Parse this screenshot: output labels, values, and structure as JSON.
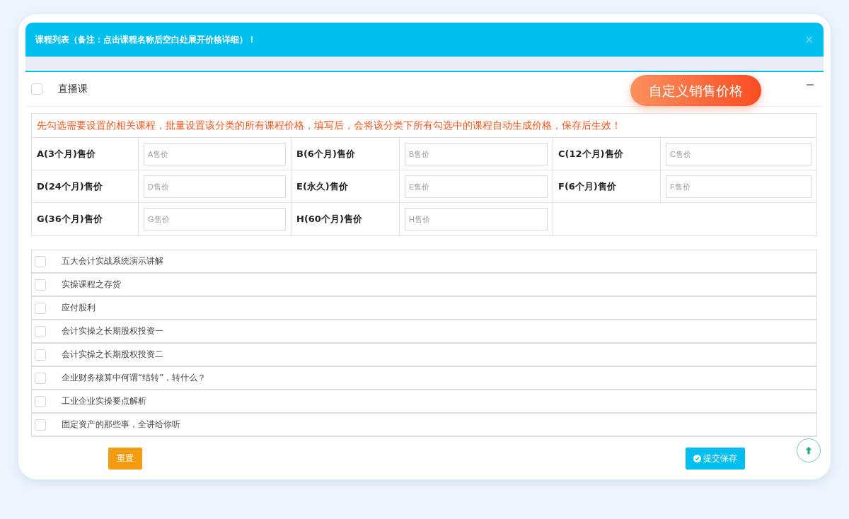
{
  "dialog": {
    "title": "课程列表（备注：点击课程名称后空白处展开价格详细）！",
    "close": "×"
  },
  "category": {
    "label": "直播课",
    "checked": false
  },
  "badge": "自定义销售价格",
  "notice": "先勾选需要设置的相关课程，批量设置该分类的所有课程价格，填写后，会将该分类下所有勾选中的课程自动生成价格，保存后生效！",
  "price_fields": [
    {
      "label": "A(3个月)售价",
      "placeholder": "A售价"
    },
    {
      "label": "B(6个月)售价",
      "placeholder": "B售价"
    },
    {
      "label": "C(12个月)售价",
      "placeholder": "C售价"
    },
    {
      "label": "D(24个月)售价",
      "placeholder": "D售价"
    },
    {
      "label": "E(永久)售价",
      "placeholder": "E售价"
    },
    {
      "label": "F(6个月)售价",
      "placeholder": "F售价"
    },
    {
      "label": "G(36个月)售价",
      "placeholder": "G售价"
    },
    {
      "label": "H(60个月)售价",
      "placeholder": "H售价"
    }
  ],
  "courses": [
    {
      "name": "五大会计实战系统演示讲解",
      "checked": false
    },
    {
      "name": "实操课程之存货",
      "checked": false
    },
    {
      "name": "应付股利",
      "checked": false
    },
    {
      "name": "会计实操之长期股权投资一",
      "checked": false
    },
    {
      "name": "会计实操之长期股权投资二",
      "checked": false
    },
    {
      "name": "企业财务核算中何谓“结转”，转什么？",
      "checked": false
    },
    {
      "name": "工业企业实操要点解析",
      "checked": false
    },
    {
      "name": "固定资产的那些事，全讲给你听",
      "checked": false
    }
  ],
  "buttons": {
    "reset": "重置",
    "submit": "提交保存"
  }
}
